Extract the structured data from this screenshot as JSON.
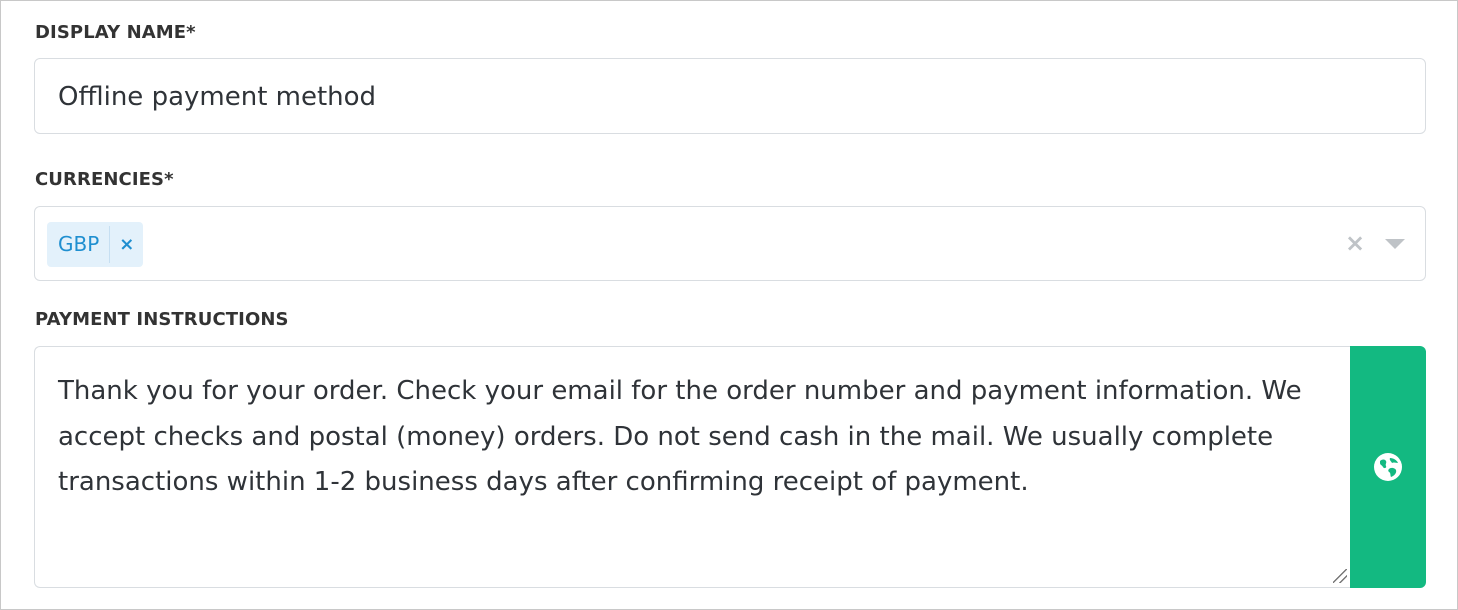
{
  "form": {
    "display_name": {
      "label": "DISPLAY NAME*",
      "value": "Offline payment method"
    },
    "currencies": {
      "label": "CURRENCIES*",
      "selected": [
        "GBP"
      ],
      "tag_remove_glyph": "×",
      "clear_glyph": "×"
    },
    "payment_instructions": {
      "label": "PAYMENT INSTRUCTIONS",
      "value": "Thank you for your order. Check your email for the order number and payment information. We accept checks and postal (money) orders. Do not send cash in the mail. We usually complete transactions within 1-2 business days after confirming receipt of payment.",
      "side_button_icon": "globe-icon",
      "side_button_color": "#13b981"
    }
  },
  "colors": {
    "tag_bg": "#e3f1fb",
    "tag_text": "#1f8fd0",
    "border": "#d9dde1"
  }
}
